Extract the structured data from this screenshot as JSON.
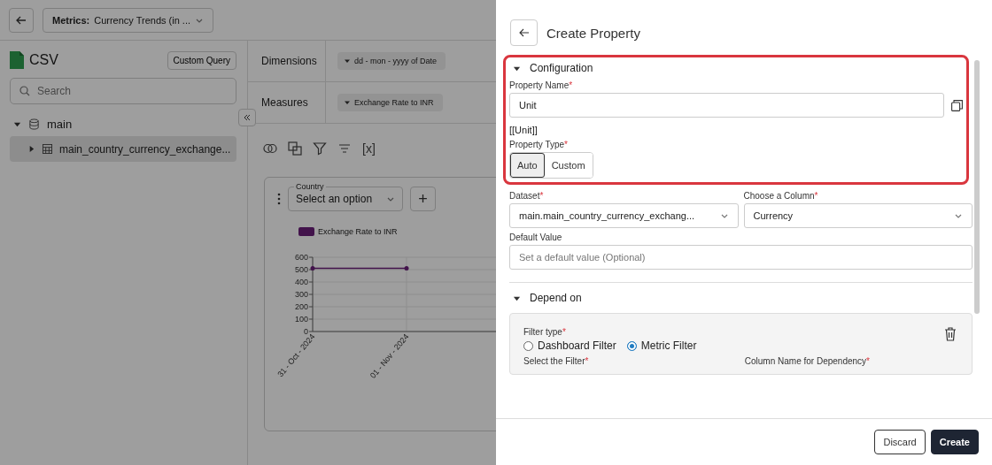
{
  "top_bar": {
    "metric_selector": {
      "prefix": "Metrics:",
      "value": "Currency Trends (in ..."
    }
  },
  "sidebar": {
    "source_name": "CSV",
    "custom_query_button": "Custom Query",
    "search": {
      "placeholder": "Search"
    },
    "tree": [
      {
        "label": "main",
        "expanded": true,
        "selected": false,
        "children": [
          {
            "label": "main_country_currency_exchange...",
            "expanded": false,
            "selected": true
          }
        ]
      }
    ]
  },
  "query": {
    "rows": [
      {
        "label": "Dimensions",
        "chips": [
          "dd - mon - yyyy of Date"
        ]
      },
      {
        "label": "Measures",
        "chips": [
          "Exchange Rate to INR"
        ]
      }
    ]
  },
  "toolbar": {
    "variable_button": "[x]"
  },
  "chart_card": {
    "filter": {
      "label": "Country",
      "placeholder": "Select an option"
    },
    "add_button": "+",
    "chart_data": {
      "type": "line",
      "categories": [
        "31 - Oct - 2024",
        "01 - Nov - 2024"
      ],
      "series": [
        {
          "name": "Exchange Rate to INR",
          "color": "#6b1f7a",
          "values": [
            510,
            510
          ]
        }
      ],
      "grid": true,
      "ylim": [
        0,
        600
      ],
      "yticks": [
        0,
        100,
        200,
        300,
        400,
        500,
        600
      ]
    }
  },
  "drawer": {
    "title": "Create Property",
    "configuration": {
      "title": "Configuration",
      "expanded": true,
      "highlighted": true,
      "property_name": {
        "label": "Property Name",
        "mark": "*",
        "value": "Unit"
      },
      "token": "[[Unit]]",
      "property_type": {
        "label": "Property Type",
        "mark": "*",
        "options": [
          {
            "label": "Auto",
            "selected": true
          },
          {
            "label": "Custom",
            "selected": false
          }
        ]
      }
    },
    "dataset": {
      "label": "Dataset",
      "mark": "*",
      "value": "main.main_country_currency_exchang..."
    },
    "column": {
      "label": "Choose a Column",
      "mark": "*",
      "value": "Currency"
    },
    "default_value": {
      "label": "Default Value",
      "placeholder": "Set a default value (Optional)"
    },
    "depend_on": {
      "title": "Depend on",
      "expanded": true,
      "filter_type": {
        "label": "Filter type",
        "mark": "*",
        "options": [
          {
            "label": "Dashboard Filter",
            "selected": false
          },
          {
            "label": "Metric Filter",
            "selected": true
          }
        ]
      },
      "select_filter": {
        "label": "Select the Filter",
        "mark": "*"
      },
      "column_name": {
        "label": "Column Name for Dependency",
        "mark": "*"
      }
    },
    "buttons": [
      {
        "label": "Discard",
        "kind": "secondary"
      },
      {
        "label": "Create",
        "kind": "primary"
      }
    ]
  }
}
